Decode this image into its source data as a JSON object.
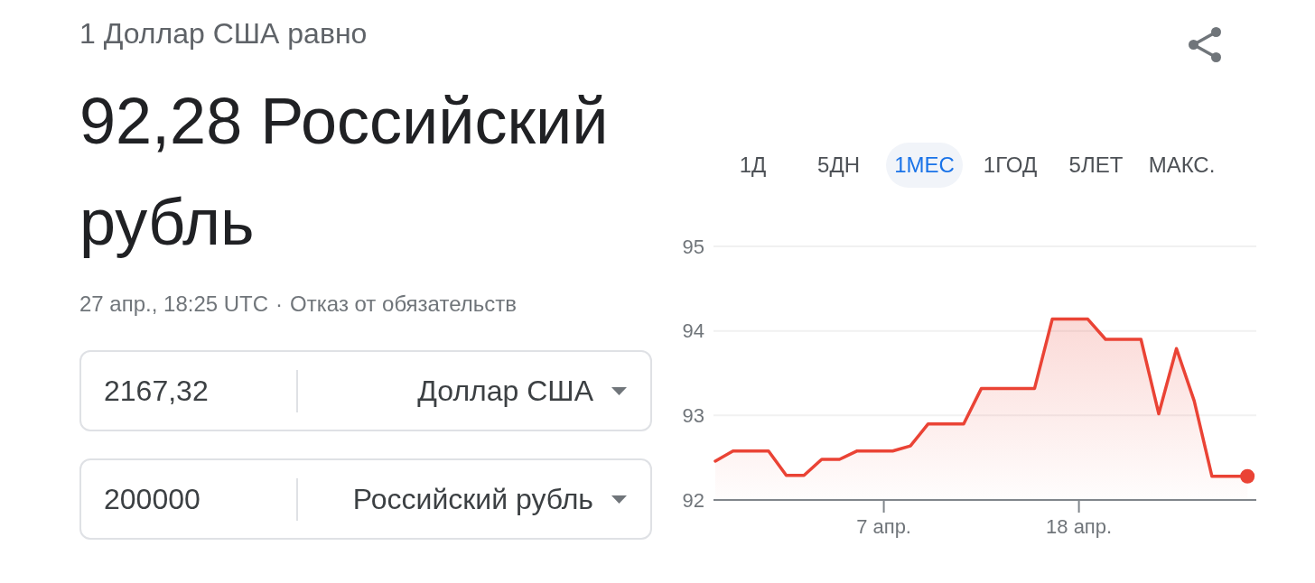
{
  "header": {
    "subtitle": "1 Доллар США равно",
    "result": "92,28 Российский рубль",
    "timestamp": "27 апр., 18:25 UTC",
    "separator": "·",
    "disclaimer": "Отказ от обязательств"
  },
  "converters": [
    {
      "amount": "2167,32",
      "currency": "Доллар США"
    },
    {
      "amount": "200000",
      "currency": "Российский рубль"
    }
  ],
  "range_tabs": [
    {
      "label": "1Д",
      "selected": false
    },
    {
      "label": "5ДН",
      "selected": false
    },
    {
      "label": "1МЕС",
      "selected": true
    },
    {
      "label": "1ГОД",
      "selected": false
    },
    {
      "label": "5ЛЕТ",
      "selected": false
    },
    {
      "label": "МАКС.",
      "selected": false
    }
  ],
  "chart": {
    "chart_data": {
      "type": "area",
      "x": [
        -2.5,
        -1.5,
        -0.5,
        0.5,
        1.5,
        2.5,
        3.5,
        4.5,
        5.5,
        6.5,
        7.5,
        8.5,
        9.5,
        10.5,
        11.5,
        12.5,
        13.5,
        14.5,
        15.5,
        16.5,
        17.5,
        18.5,
        19.5,
        20.5,
        21.5,
        22.5,
        23.5,
        24.5,
        25.5,
        26.5,
        27.5
      ],
      "values": [
        92.46,
        92.58,
        92.58,
        92.58,
        92.29,
        92.29,
        92.48,
        92.48,
        92.58,
        92.58,
        92.58,
        92.64,
        92.9,
        92.9,
        92.9,
        93.32,
        93.32,
        93.32,
        93.32,
        94.14,
        94.14,
        94.14,
        93.9,
        93.9,
        93.9,
        93.02,
        93.79,
        93.17,
        92.28,
        92.28,
        92.28
      ],
      "xlim": [
        -2.5,
        28
      ],
      "ylim": [
        92,
        95
      ],
      "yticks": [
        92,
        93,
        94,
        95
      ],
      "xticks": [
        {
          "value": 7,
          "label": "7 апр."
        },
        {
          "value": 18,
          "label": "18 апр."
        }
      ]
    }
  }
}
